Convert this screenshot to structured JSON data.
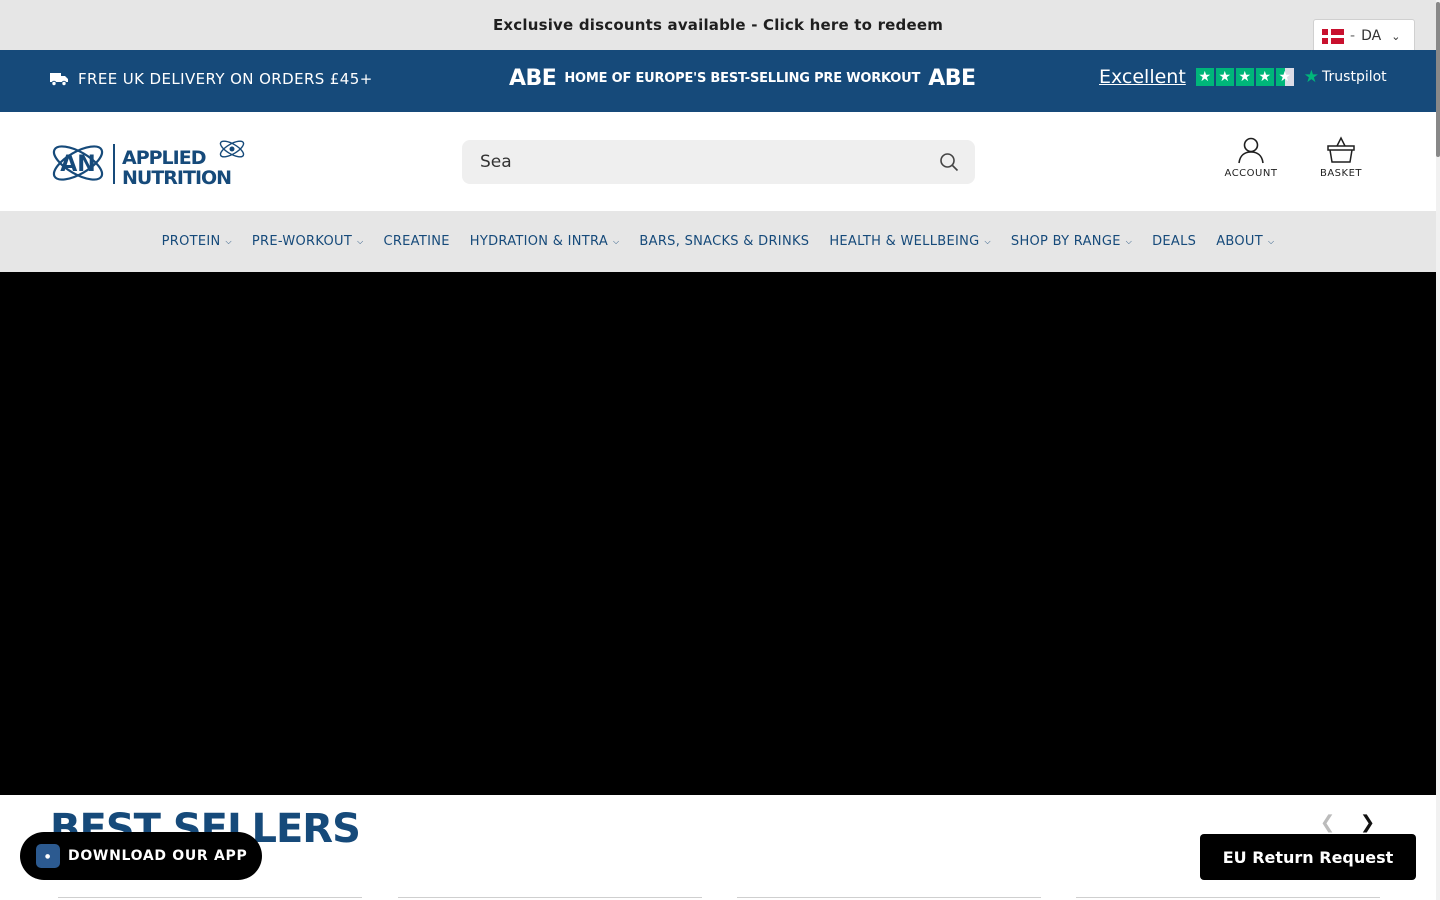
{
  "promo": {
    "text": "Exclusive discounts available - Click here to redeem"
  },
  "country": {
    "code": "DA",
    "separator": "-"
  },
  "blue_bar": {
    "delivery": "FREE UK DELIVERY ON ORDERS £45+",
    "abe_logo": "ABE",
    "abe_tagline": "HOME OF EUROPE'S BEST-SELLING PRE WORKOUT",
    "trustpilot_rating": "Excellent",
    "trustpilot_brand": "Trustpilot",
    "trustpilot_stars": 4.5
  },
  "logo": {
    "monogram": "AN",
    "line1": "APPLIED",
    "line2": "NUTRITION"
  },
  "search": {
    "value": "Sea"
  },
  "header": {
    "account_label": "ACCOUNT",
    "basket_label": "BASKET"
  },
  "nav": {
    "items": [
      {
        "label": "PROTEIN",
        "has_dropdown": true
      },
      {
        "label": "PRE-WORKOUT",
        "has_dropdown": true
      },
      {
        "label": "CREATINE",
        "has_dropdown": false
      },
      {
        "label": "HYDRATION & INTRA",
        "has_dropdown": true
      },
      {
        "label": "BARS, SNACKS & DRINKS",
        "has_dropdown": false
      },
      {
        "label": "HEALTH & WELLBEING",
        "has_dropdown": true
      },
      {
        "label": "SHOP BY RANGE",
        "has_dropdown": true
      },
      {
        "label": "DEALS",
        "has_dropdown": false
      },
      {
        "label": "ABOUT",
        "has_dropdown": true
      }
    ]
  },
  "section": {
    "title": "BEST SELLERS"
  },
  "floating": {
    "app_button": "DOWNLOAD OUR APP",
    "eu_return": "EU Return Request"
  },
  "colors": {
    "brand_blue": "#164a7a",
    "trustpilot_green": "#00b67a",
    "nav_bg": "#e6e6e6"
  }
}
